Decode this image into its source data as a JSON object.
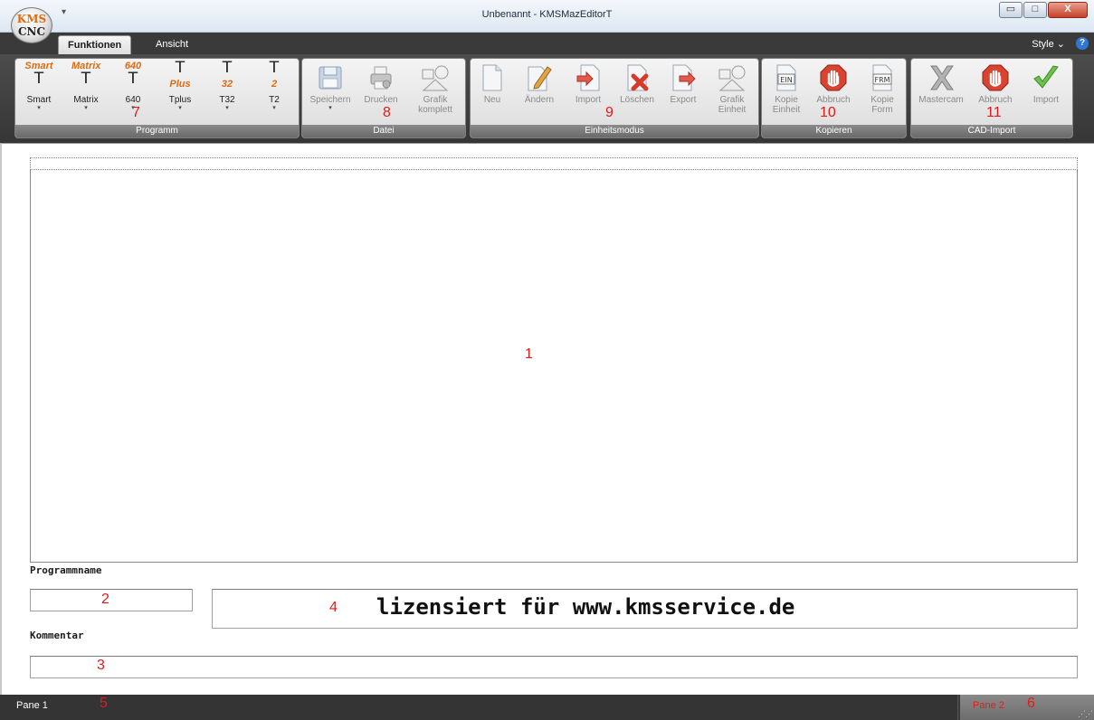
{
  "window": {
    "title": "Unbenannt - KMSMazEditorT",
    "logo_top": "KMS",
    "logo_bottom": "CNC",
    "quick_access_arrow": "▾",
    "minimize_symbol": "▭",
    "maximize_symbol": "□",
    "close_symbol": "X"
  },
  "tabs": {
    "funktionen": "Funktionen",
    "ansicht": "Ansicht",
    "style": "Style ⌄",
    "help": "?"
  },
  "ribbon": {
    "programm": {
      "label": "Programm",
      "buttons": [
        {
          "top": "Smart",
          "label": "Smart"
        },
        {
          "top": "Matrix",
          "label": "Matrix"
        },
        {
          "top": "640",
          "label": "640"
        },
        {
          "top": "Plus",
          "label": "Tplus"
        },
        {
          "top": "32",
          "label": "T32"
        },
        {
          "top": "2",
          "label": "T2"
        }
      ]
    },
    "datei": {
      "label": "Datei",
      "speichern": "Speichern",
      "drucken": "Drucken",
      "grafik_komplett_1": "Grafik",
      "grafik_komplett_2": "komplett"
    },
    "einheitsmodus": {
      "label": "Einheitsmodus",
      "neu": "Neu",
      "aendern": "Ändern",
      "import": "Import",
      "loeschen": "Löschen",
      "export": "Export",
      "grafik_einheit_1": "Grafik",
      "grafik_einheit_2": "Einheit"
    },
    "kopieren": {
      "label": "Kopieren",
      "kopie_einheit_1": "Kopie",
      "kopie_einheit_2": "Einheit",
      "ein_icon_text": "EIN",
      "abbruch": "Abbruch",
      "kopie_form_1": "Kopie",
      "kopie_form_2": "Form",
      "frm_icon_text": "FRM"
    },
    "cad_import": {
      "label": "CAD-Import",
      "mastercam": "Mastercam",
      "abbruch": "Abbruch",
      "import": "Import"
    }
  },
  "annotations": {
    "n1": "1",
    "n2": "2",
    "n3": "3",
    "n4": "4",
    "n5": "5",
    "n6": "6",
    "n7": "7",
    "n8": "8",
    "n9": "9",
    "n10": "10",
    "n11": "11"
  },
  "form": {
    "programmname_label": "Programmname",
    "programmname_value": "",
    "kommentar_label": "Kommentar",
    "kommentar_value": "",
    "license_text": "lizensiert für www.kmsservice.de"
  },
  "statusbar": {
    "pane1": "Pane 1",
    "pane2": "Pane 2"
  },
  "colors": {
    "accent_orange": "#e06a10",
    "annotation_red": "#e11a1a",
    "ribbon_dark": "#3a3a3a"
  }
}
